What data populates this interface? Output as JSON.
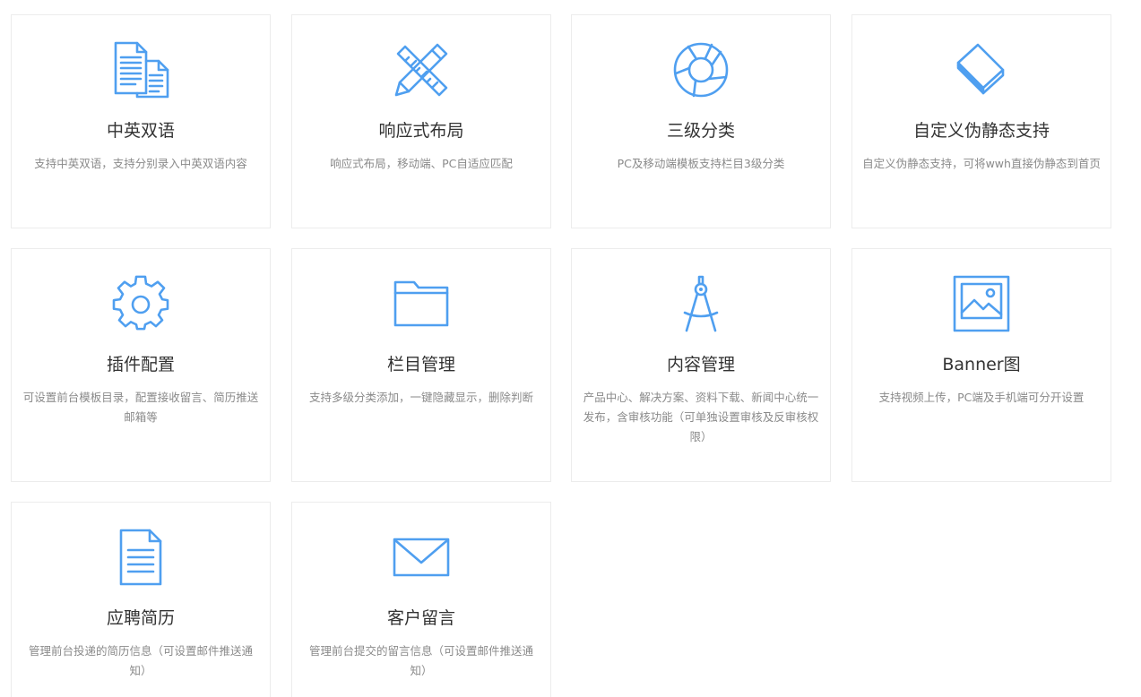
{
  "accent_color": "#4f9ff0",
  "features": [
    {
      "title": "中英双语",
      "desc": "支持中英双语，支持分别录入中英双语内容",
      "icon": "documents-icon"
    },
    {
      "title": "响应式布局",
      "desc": "响应式布局，移动端、PC自适应匹配",
      "icon": "pencil-ruler-icon"
    },
    {
      "title": "三级分类",
      "desc": "PC及移动端模板支持栏目3级分类",
      "icon": "aperture-icon"
    },
    {
      "title": "自定义伪静态支持",
      "desc": "自定义伪静态支持，可将wwh直接伪静态到首页",
      "icon": "book-icon"
    },
    {
      "title": "插件配置",
      "desc": "可设置前台模板目录，配置接收留言、简历推送邮箱等",
      "icon": "gear-icon"
    },
    {
      "title": "栏目管理",
      "desc": "支持多级分类添加，一键隐藏显示，删除判断",
      "icon": "folder-icon"
    },
    {
      "title": "内容管理",
      "desc": "产品中心、解决方案、资料下载、新闻中心统一发布，含审核功能（可单独设置审核及反审核权限）",
      "icon": "compass-icon"
    },
    {
      "title": "Banner图",
      "desc": "支持视频上传，PC端及手机端可分开设置",
      "icon": "image-icon"
    },
    {
      "title": "应聘简历",
      "desc": "管理前台投递的简历信息（可设置邮件推送通知）",
      "icon": "resume-icon"
    },
    {
      "title": "客户留言",
      "desc": "管理前台提交的留言信息（可设置邮件推送通知）",
      "icon": "envelope-icon"
    }
  ]
}
